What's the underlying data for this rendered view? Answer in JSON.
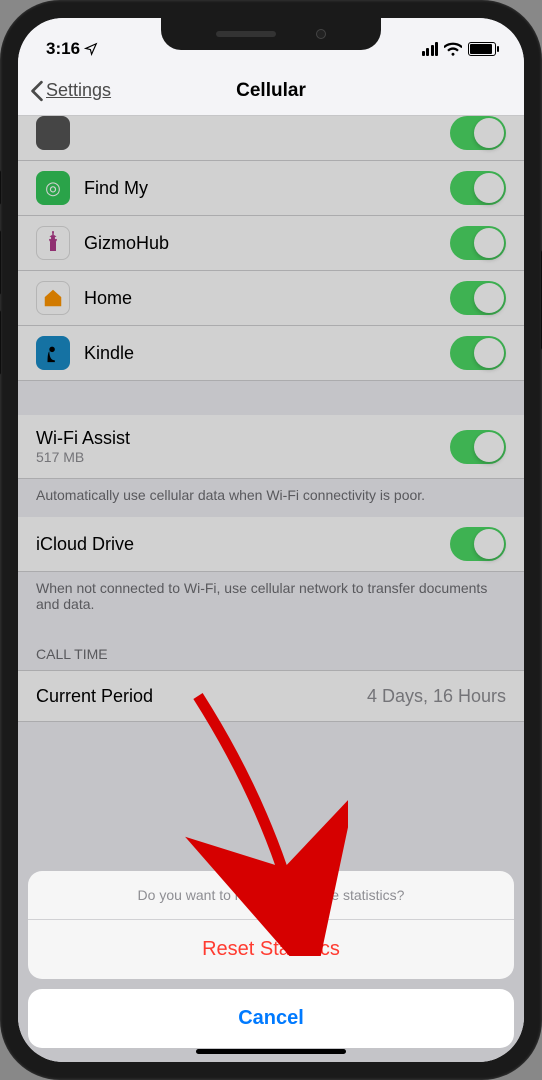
{
  "status": {
    "time": "3:16",
    "location_icon": "location-arrow-icon"
  },
  "nav": {
    "back_label": "Settings",
    "title": "Cellular"
  },
  "apps": [
    {
      "name": "Find My",
      "icon_bg": "#34c759",
      "icon_glyph": "◎",
      "icon_color": "#fff"
    },
    {
      "name": "GizmoHub",
      "icon_bg": "#ffffff",
      "icon_glyph": "🤖",
      "icon_color": "#b03a8a"
    },
    {
      "name": "Home",
      "icon_bg": "#ffffff",
      "icon_glyph": "🏠",
      "icon_color": "#ff9500"
    },
    {
      "name": "Kindle",
      "icon_bg": "#1a8cc7",
      "icon_glyph": "📖",
      "icon_color": "#fff"
    }
  ],
  "wifi_assist": {
    "label": "Wi-Fi Assist",
    "subtitle": "517 MB",
    "footer": "Automatically use cellular data when Wi-Fi connectivity is poor."
  },
  "icloud_drive": {
    "label": "iCloud Drive",
    "footer": "When not connected to Wi-Fi, use cellular network to transfer documents and data."
  },
  "call_time": {
    "header": "CALL TIME",
    "current_label": "Current Period",
    "current_value": "4 Days, 16 Hours"
  },
  "action_sheet": {
    "message": "Do you want to reset your usage statistics?",
    "destructive": "Reset Statistics",
    "cancel": "Cancel"
  }
}
